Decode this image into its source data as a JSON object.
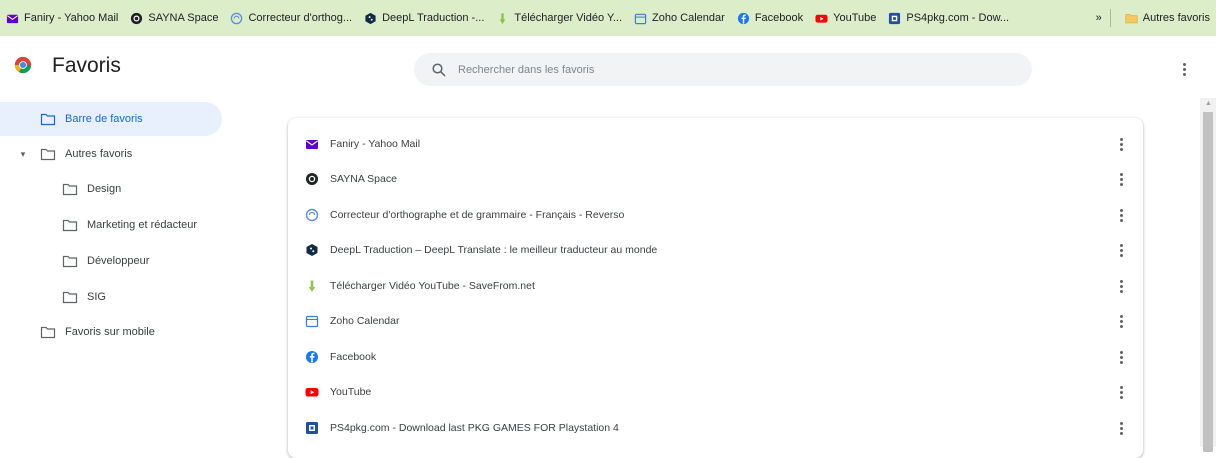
{
  "bookmarks_bar": {
    "items": [
      {
        "label": "Faniry - Yahoo Mail",
        "icon": "yahoo-mail-icon",
        "color": "#6001d2"
      },
      {
        "label": "SAYNA Space",
        "icon": "sayna-icon",
        "color": "#202124"
      },
      {
        "label": "Correcteur d'orthog...",
        "icon": "reverso-icon",
        "color": "#5b8fd6"
      },
      {
        "label": "DeepL Traduction -...",
        "icon": "deepl-icon",
        "color": "#0f2b46"
      },
      {
        "label": "Télécharger Vidéo Y...",
        "icon": "savefrom-icon",
        "color": "#8bc34a"
      },
      {
        "label": "Zoho Calendar",
        "icon": "zoho-calendar-icon",
        "color": "#3b7ddd"
      },
      {
        "label": "Facebook",
        "icon": "facebook-icon",
        "color": "#1877f2"
      },
      {
        "label": "YouTube",
        "icon": "youtube-icon",
        "color": "#ff0000"
      },
      {
        "label": "PS4pkg.com - Dow...",
        "icon": "ps4pkg-icon",
        "color": "#1e4fa3"
      }
    ],
    "more": "»",
    "other_folder": "Autres favoris"
  },
  "header": {
    "title": "Favoris",
    "search_placeholder": "Rechercher dans les favoris",
    "menu_icon": "more-vert-icon"
  },
  "tree": [
    {
      "label": "Barre de favoris",
      "depth": 0,
      "selected": true,
      "expander": ""
    },
    {
      "label": "Autres favoris",
      "depth": 0,
      "selected": false,
      "expander": "▾"
    },
    {
      "label": "Design",
      "depth": 1,
      "selected": false,
      "expander": ""
    },
    {
      "label": "Marketing et rédacteur",
      "depth": 1,
      "selected": false,
      "expander": ""
    },
    {
      "label": "Développeur",
      "depth": 1,
      "selected": false,
      "expander": ""
    },
    {
      "label": "SIG",
      "depth": 1,
      "selected": false,
      "expander": ""
    },
    {
      "label": "Favoris sur mobile",
      "depth": 0,
      "selected": false,
      "expander": ""
    }
  ],
  "list": [
    {
      "title": "Faniry - Yahoo Mail",
      "icon": "yahoo-mail-icon",
      "color": "#6001d2"
    },
    {
      "title": "SAYNA Space",
      "icon": "sayna-icon",
      "color": "#202124"
    },
    {
      "title": "Correcteur d'orthographe et de grammaire - Français - Reverso",
      "icon": "reverso-icon",
      "color": "#5b8fd6"
    },
    {
      "title": "DeepL Traduction – DeepL Translate : le meilleur traducteur au monde",
      "icon": "deepl-icon",
      "color": "#0f2b46"
    },
    {
      "title": "Télécharger Vidéo YouTube - SaveFrom.net",
      "icon": "savefrom-icon",
      "color": "#8bc34a"
    },
    {
      "title": "Zoho Calendar",
      "icon": "zoho-calendar-icon",
      "color": "#3b7ddd"
    },
    {
      "title": "Facebook",
      "icon": "facebook-icon",
      "color": "#1877f2"
    },
    {
      "title": "YouTube",
      "icon": "youtube-icon",
      "color": "#ff0000"
    },
    {
      "title": "PS4pkg.com - Download last PKG GAMES FOR Playstation 4",
      "icon": "ps4pkg-icon",
      "color": "#1e4fa3"
    }
  ],
  "colors": {
    "bookmarks_bar_bg": "#dbeec9",
    "selected_bg": "#e8f0fe",
    "selected_text": "#1967d2",
    "folder_icon": "#5f6368"
  }
}
